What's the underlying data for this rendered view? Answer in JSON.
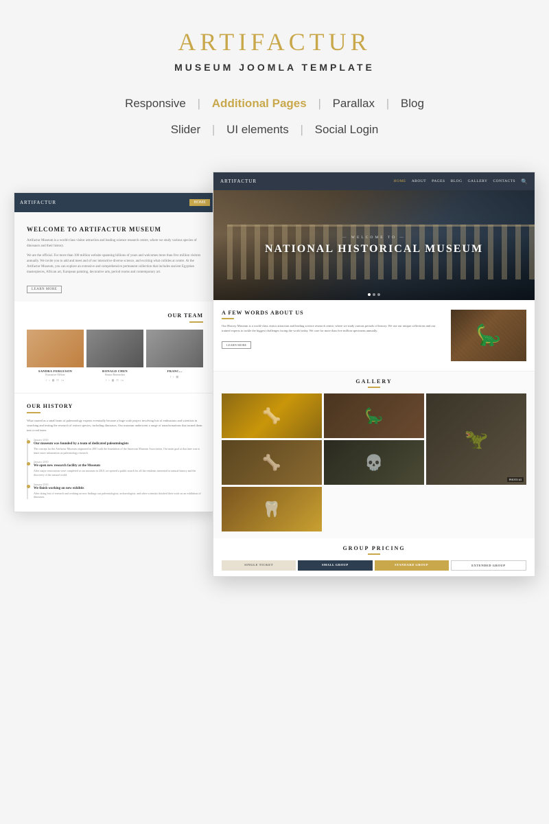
{
  "header": {
    "brand_name": "ARTIFACTUR",
    "brand_subtitle": "Museum Joomla Template",
    "features": [
      "Responsive",
      "Additional Pages",
      "Parallax",
      "Blog",
      "Slider",
      "UI elements",
      "Social Login"
    ]
  },
  "left_screenshot": {
    "nav_logo": "ARTIFACTUR",
    "nav_home": "HOME",
    "hero_title": "WELCOME TO ARTIFACTUR MUSEUM",
    "hero_text1": "Artifactur Museum is a world-class visitor attraction and leading science research centre, where we study various species of dinosaurs and their history.",
    "hero_text2": "We are the official. For more than 100 million website spanning billions of years and welcomes more than five million visitors annually. We invite you to add and meet and of our interactive diverse science, and exciting what collides at centre. At the Artifactur Museum, you can explore an extensive and comprehensive permanent collection that includes ancient Egyptian masterpieces, African art, European painting, decorative arts, period rooms and contemporary art.",
    "hero_btn": "LEARN MORE",
    "team_title": "OUR TEAM",
    "team_members": [
      {
        "name": "SANDRA FERGUSON",
        "role": "Executive Officer"
      },
      {
        "name": "RONALD CHEN",
        "role": "Senior Researcher"
      },
      {
        "name": "FRANC...",
        "role": ""
      }
    ],
    "history_title": "OUR HISTORY",
    "history_text": "What started as a small team of paleontology experts eventually became a huge scale project involving lots of enthusiasts and scientists in searching and testing the research of extinct species, including dinosaurs. Our museum underwent a range of transformations that turned them into a real team.",
    "timeline": [
      {
        "date": "January 2016",
        "heading": "Our museum was founded by a team of dedicated paleontologists",
        "text": "The concept for the Artifactur Museum originated in 2001 with the foundation of the American Museum Association. Our main goal at that time was to share more information on paleontology research."
      },
      {
        "date": "January 2010",
        "heading": "We open new research facility at the Museum",
        "text": "After major renovations were completed at our museum in 2010, we opened a public event for all the residents interested in natural history and the discovery of the natural world."
      },
      {
        "date": "January 2016",
        "heading": "We finish working on new exhibits",
        "text": "After doing lots of research and working on new findings our paleontologists, archaeologists, and other scientists finished their work on an exhibition of dinosaurs."
      }
    ]
  },
  "right_screenshot": {
    "nav_logo": "ARTIFACTUR",
    "nav_links": [
      "HOME",
      "ABOUT",
      "PAGES",
      "BLOG",
      "GALLERY",
      "CONTACTS"
    ],
    "nav_active": "HOME",
    "hero_welcome": "— WELCOME TO —",
    "hero_title": "NATIONAL HISTORICAL MUSEUM",
    "about_title": "A FEW WORDS ABOUT US",
    "about_text": "Our History Museum is a world-class visitor attraction and leading science research centre, where we study various periods of history. We use our unique collections and our trained experts to tackle the biggest challenges facing the world today. We care for more than five million specimens annually.",
    "about_btn": "LEARN MORE",
    "gallery_title": "GALLERY",
    "gallery_photos": [
      {
        "label": null,
        "bg": "gallery-bg-1"
      },
      {
        "label": null,
        "bg": "gallery-bg-2"
      },
      {
        "label": "PHOTO #3",
        "bg": "gallery-bg-3"
      },
      {
        "label": null,
        "bg": "gallery-bg-4"
      },
      {
        "label": null,
        "bg": "gallery-bg-5"
      },
      {
        "label": null,
        "bg": "gallery-bg-6"
      }
    ],
    "pricing_title": "GROUP PRICING",
    "pricing_tabs": [
      {
        "label": "SINGLE TICKET",
        "style": "light"
      },
      {
        "label": "SMALL GROUP",
        "style": "dark"
      },
      {
        "label": "STANDARD GROUP",
        "style": "gold"
      },
      {
        "label": "EXTENDED GROUP",
        "style": "outline"
      }
    ]
  }
}
